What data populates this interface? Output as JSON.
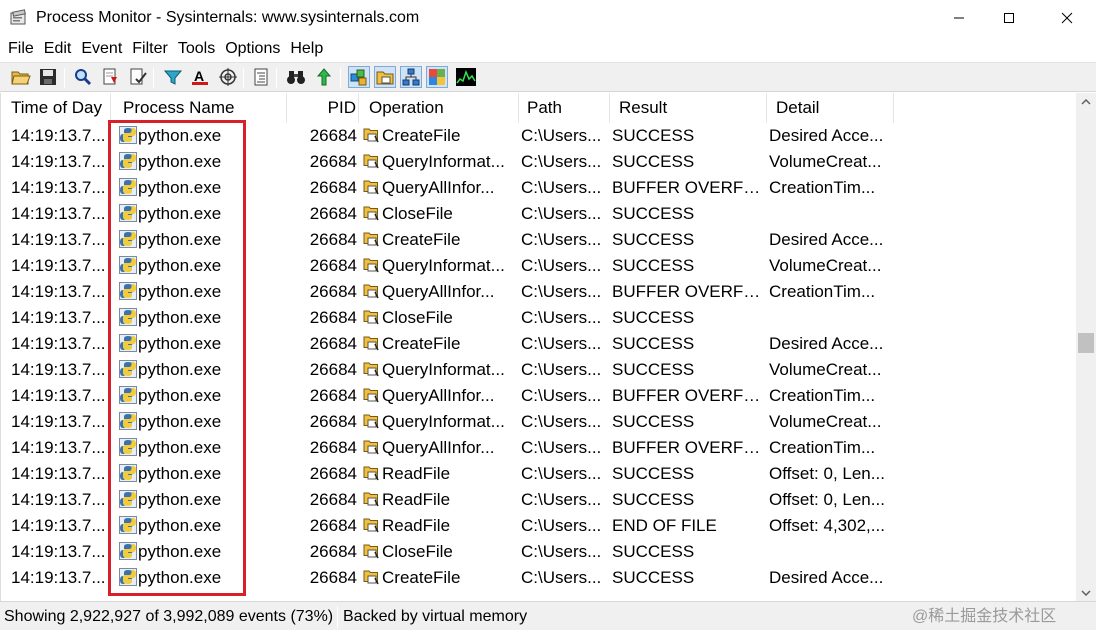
{
  "window": {
    "title": "Process Monitor - Sysinternals: www.sysinternals.com"
  },
  "menu": [
    "File",
    "Edit",
    "Event",
    "Filter",
    "Tools",
    "Options",
    "Help"
  ],
  "toolbar": {
    "icons": [
      "open-icon",
      "save-icon",
      "magnify-icon",
      "autoscroll-icon",
      "clear-icon",
      "filter-icon",
      "highlight-icon",
      "target-icon",
      "tree-icon",
      "find-icon",
      "jump-icon",
      "registry-icon",
      "file-icon",
      "network-icon",
      "process-icon",
      "profiling-icon"
    ]
  },
  "columns": {
    "time": "Time of Day",
    "process": "Process Name",
    "pid": "PID",
    "operation": "Operation",
    "path": "Path",
    "result": "Result",
    "detail": "Detail"
  },
  "rows": [
    {
      "time": "14:19:13.7...",
      "process": "python.exe",
      "pid": "26684",
      "operation": "CreateFile",
      "path": "C:\\Users...",
      "result": "SUCCESS",
      "detail": "Desired Acce..."
    },
    {
      "time": "14:19:13.7...",
      "process": "python.exe",
      "pid": "26684",
      "operation": "QueryInformat...",
      "path": "C:\\Users...",
      "result": "SUCCESS",
      "detail": "VolumeCreat..."
    },
    {
      "time": "14:19:13.7...",
      "process": "python.exe",
      "pid": "26684",
      "operation": "QueryAllInfor...",
      "path": "C:\\Users...",
      "result": "BUFFER OVERFL...",
      "detail": "CreationTim..."
    },
    {
      "time": "14:19:13.7...",
      "process": "python.exe",
      "pid": "26684",
      "operation": "CloseFile",
      "path": "C:\\Users...",
      "result": "SUCCESS",
      "detail": ""
    },
    {
      "time": "14:19:13.7...",
      "process": "python.exe",
      "pid": "26684",
      "operation": "CreateFile",
      "path": "C:\\Users...",
      "result": "SUCCESS",
      "detail": "Desired Acce..."
    },
    {
      "time": "14:19:13.7...",
      "process": "python.exe",
      "pid": "26684",
      "operation": "QueryInformat...",
      "path": "C:\\Users...",
      "result": "SUCCESS",
      "detail": "VolumeCreat..."
    },
    {
      "time": "14:19:13.7...",
      "process": "python.exe",
      "pid": "26684",
      "operation": "QueryAllInfor...",
      "path": "C:\\Users...",
      "result": "BUFFER OVERFL...",
      "detail": "CreationTim..."
    },
    {
      "time": "14:19:13.7...",
      "process": "python.exe",
      "pid": "26684",
      "operation": "CloseFile",
      "path": "C:\\Users...",
      "result": "SUCCESS",
      "detail": ""
    },
    {
      "time": "14:19:13.7...",
      "process": "python.exe",
      "pid": "26684",
      "operation": "CreateFile",
      "path": "C:\\Users...",
      "result": "SUCCESS",
      "detail": "Desired Acce..."
    },
    {
      "time": "14:19:13.7...",
      "process": "python.exe",
      "pid": "26684",
      "operation": "QueryInformat...",
      "path": "C:\\Users...",
      "result": "SUCCESS",
      "detail": "VolumeCreat..."
    },
    {
      "time": "14:19:13.7...",
      "process": "python.exe",
      "pid": "26684",
      "operation": "QueryAllInfor...",
      "path": "C:\\Users...",
      "result": "BUFFER OVERFL...",
      "detail": "CreationTim..."
    },
    {
      "time": "14:19:13.7...",
      "process": "python.exe",
      "pid": "26684",
      "operation": "QueryInformat...",
      "path": "C:\\Users...",
      "result": "SUCCESS",
      "detail": "VolumeCreat..."
    },
    {
      "time": "14:19:13.7...",
      "process": "python.exe",
      "pid": "26684",
      "operation": "QueryAllInfor...",
      "path": "C:\\Users...",
      "result": "BUFFER OVERFL...",
      "detail": "CreationTim..."
    },
    {
      "time": "14:19:13.7...",
      "process": "python.exe",
      "pid": "26684",
      "operation": "ReadFile",
      "path": "C:\\Users...",
      "result": "SUCCESS",
      "detail": "Offset: 0, Len..."
    },
    {
      "time": "14:19:13.7...",
      "process": "python.exe",
      "pid": "26684",
      "operation": "ReadFile",
      "path": "C:\\Users...",
      "result": "SUCCESS",
      "detail": "Offset: 0, Len..."
    },
    {
      "time": "14:19:13.7...",
      "process": "python.exe",
      "pid": "26684",
      "operation": "ReadFile",
      "path": "C:\\Users...",
      "result": "END OF FILE",
      "detail": "Offset: 4,302,..."
    },
    {
      "time": "14:19:13.7...",
      "process": "python.exe",
      "pid": "26684",
      "operation": "CloseFile",
      "path": "C:\\Users...",
      "result": "SUCCESS",
      "detail": ""
    },
    {
      "time": "14:19:13.7...",
      "process": "python.exe",
      "pid": "26684",
      "operation": "CreateFile",
      "path": "C:\\Users...",
      "result": "SUCCESS",
      "detail": "Desired Acce..."
    }
  ],
  "status": {
    "events": "Showing 2,922,927 of 3,992,089 events (73%)",
    "memory": "Backed by virtual memory"
  },
  "watermark": "@稀土掘金技术社区",
  "colors": {
    "highlight_border": "#d8202a",
    "toolbar_pressed": "#cfe3f7"
  }
}
